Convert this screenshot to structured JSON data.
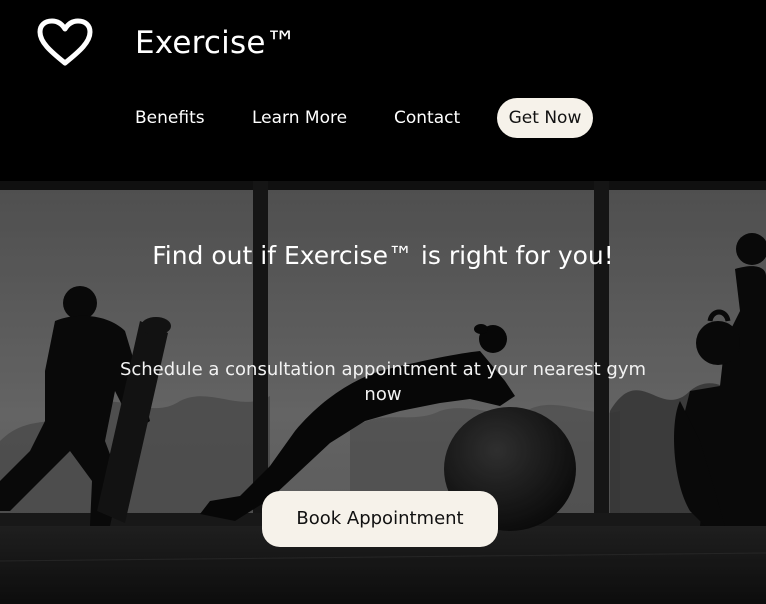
{
  "brand": {
    "logo_icon": "heart-icon",
    "name": "Exercise™"
  },
  "nav": {
    "items": [
      {
        "label": "Benefits"
      },
      {
        "label": "Learn More"
      },
      {
        "label": "Contact"
      }
    ],
    "cta_label": "Get Now"
  },
  "hero": {
    "title": "Find out if Exercise™ is right for you!",
    "subtitle": "Schedule a consultation appointment at your nearest gym now",
    "button_label": "Book Appointment",
    "image": "gym-silhouettes-photo"
  },
  "colors": {
    "header_bg": "#000000",
    "button_bg": "#f6f2ea",
    "text_light": "#ffffff"
  }
}
